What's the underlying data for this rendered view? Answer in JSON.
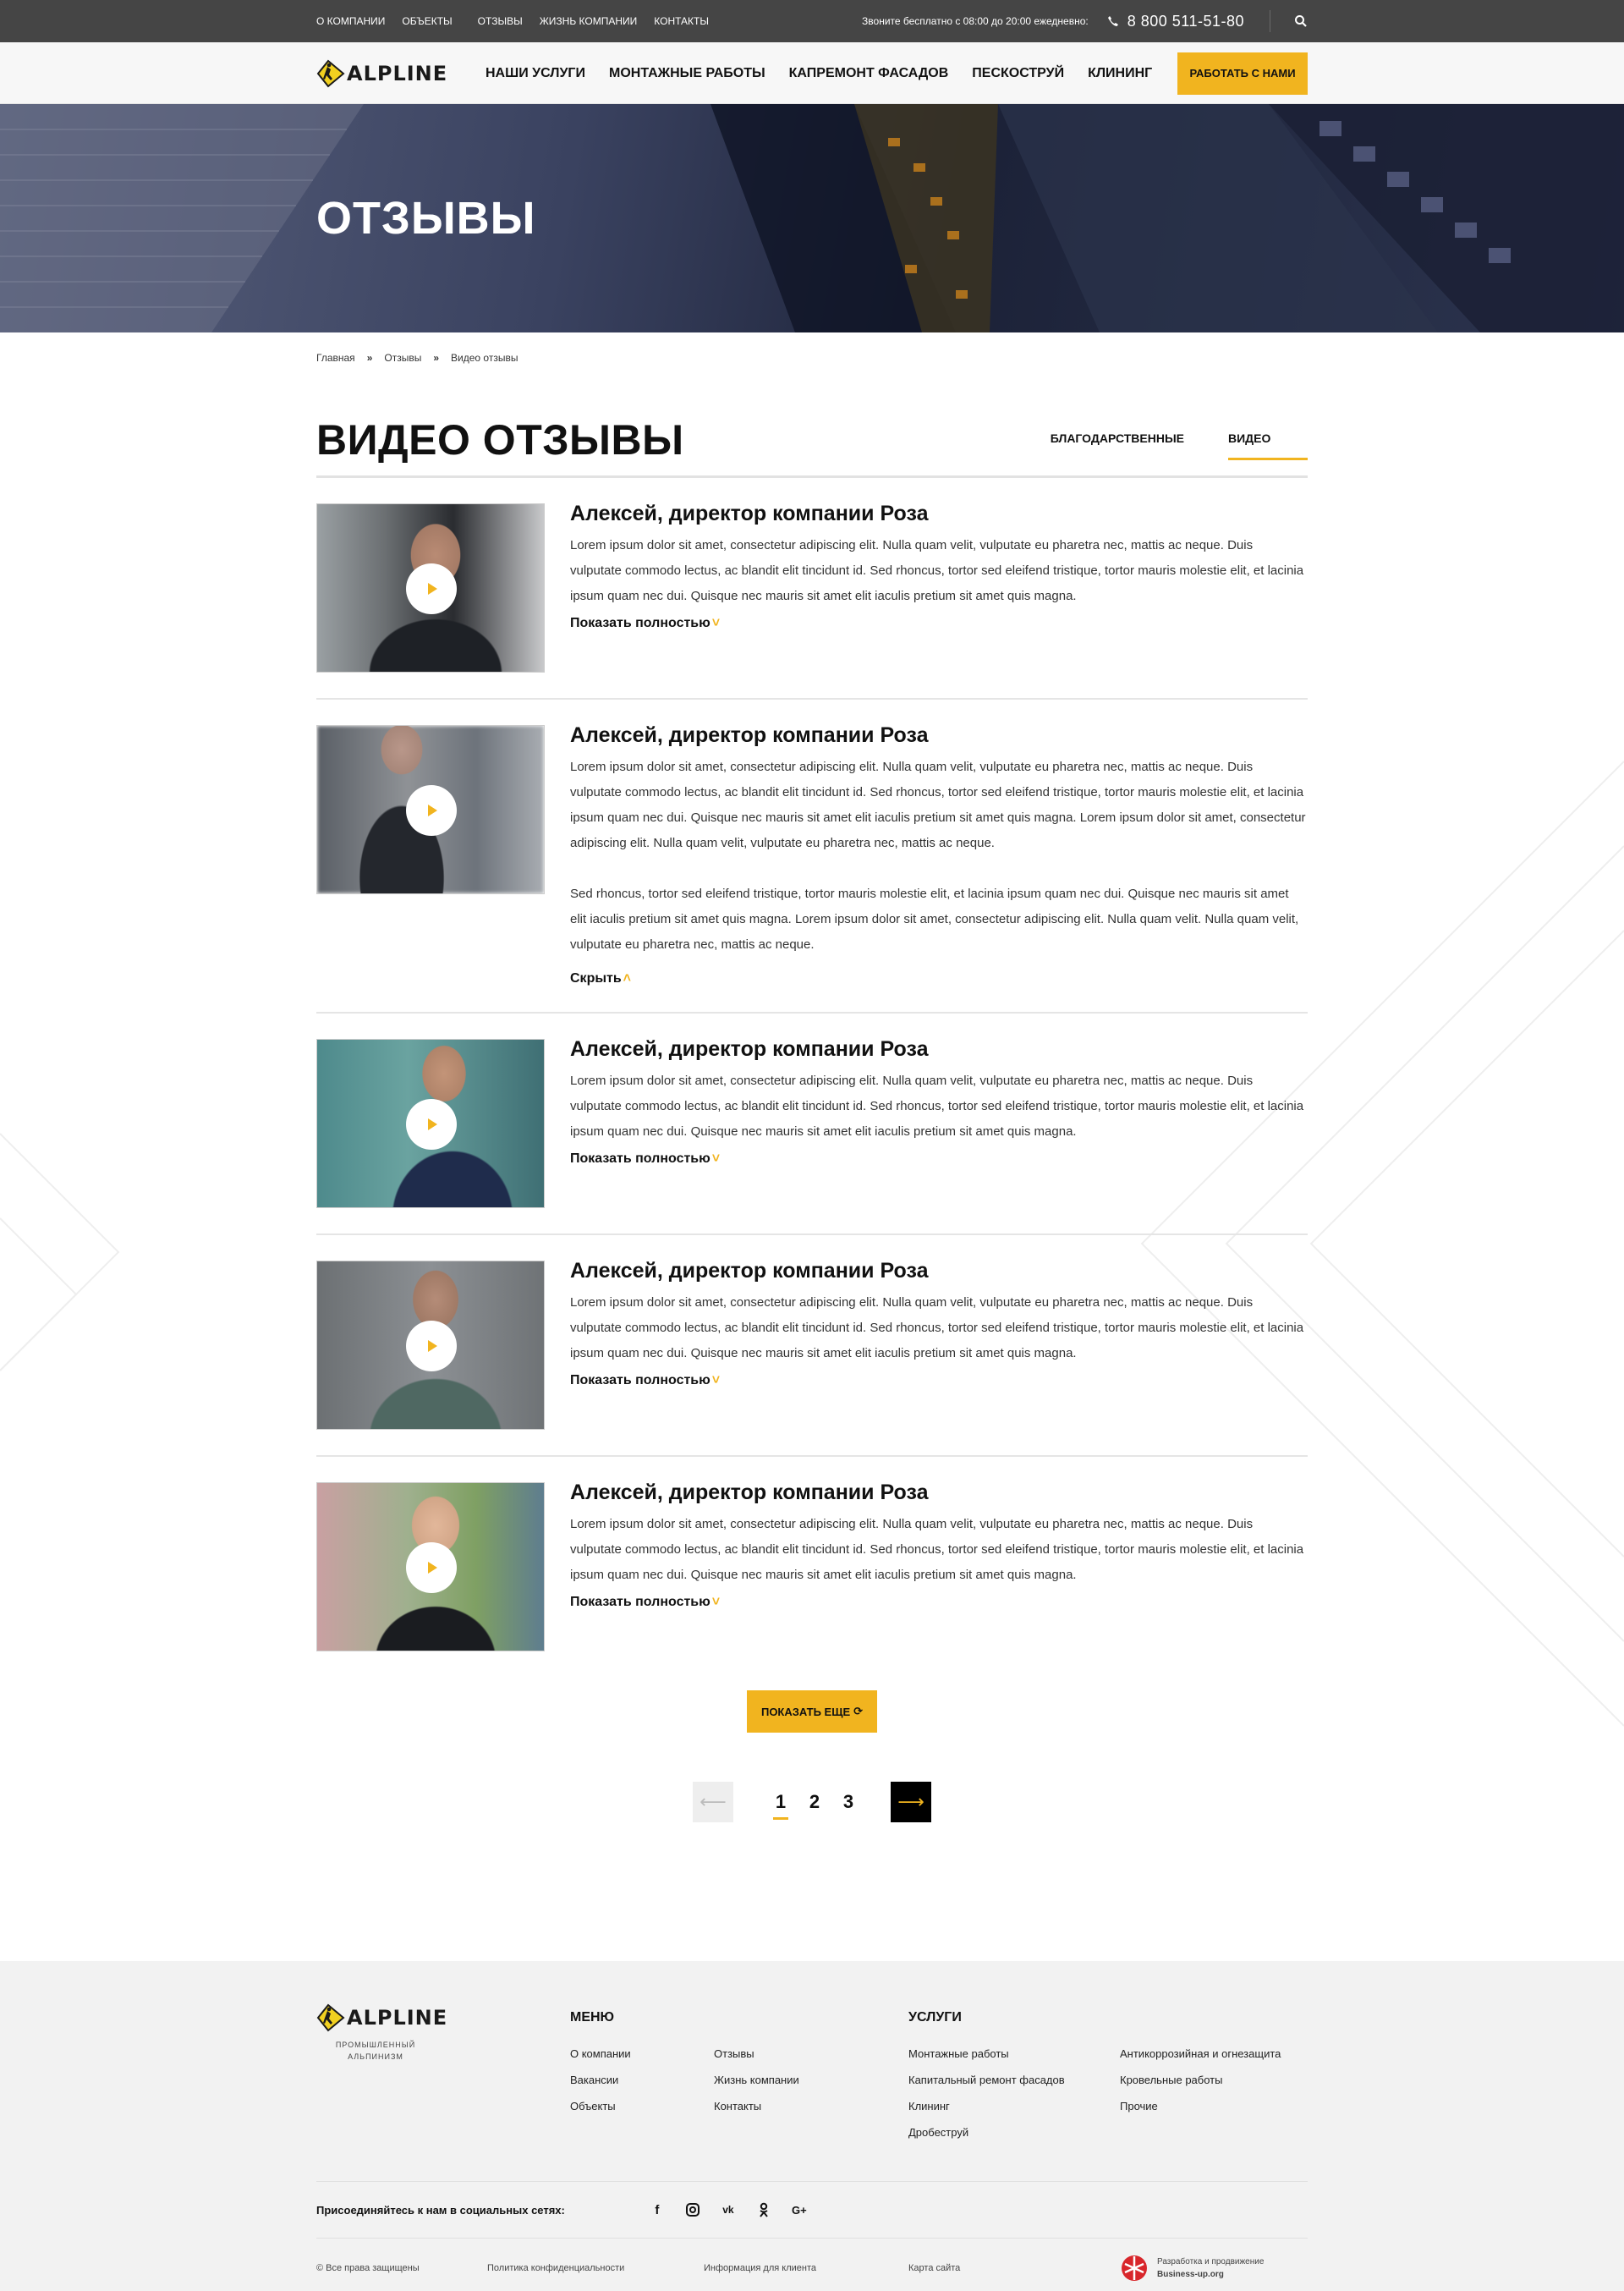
{
  "topbar": {
    "nav": [
      "О компании",
      "Объекты",
      "Отзывы",
      "Жизнь компании",
      "Контакты"
    ],
    "call_text": "Звоните бесплатно с 08:00 до 20:00 ежедневно:",
    "phone": "8 800 511-51-80"
  },
  "header": {
    "logo_text": "ALPLINE",
    "nav": [
      "Наши услуги",
      "Монтажные работы",
      "Капремонт фасадов",
      "Пескоструй",
      "Клининг"
    ],
    "cta": "Работать с нами"
  },
  "hero": {
    "title": "ОТЗЫВЫ"
  },
  "breadcrumb": [
    "Главная",
    "Отзывы",
    "Видео отзывы"
  ],
  "page": {
    "title": "ВИДЕО ОТЗЫВЫ",
    "tabs": [
      "Благодарственные",
      "Видео"
    ]
  },
  "reviews": [
    {
      "name": "Алексей, директор компании Роза",
      "text": "Lorem ipsum dolor sit amet, consectetur adipiscing elit. Nulla quam velit, vulputate eu pharetra nec, mattis ac neque. Duis vulputate commodo lectus, ac blandit elit tincidunt id. Sed rhoncus, tortor sed eleifend tristique, tortor mauris molestie elit, et lacinia ipsum quam nec dui. Quisque nec mauris sit amet elit iaculis pretium sit amet quis magna.",
      "toggle": "Показать полностью"
    },
    {
      "name": "Алексей, директор компании Роза",
      "text": "Lorem ipsum dolor sit amet, consectetur adipiscing elit. Nulla quam velit, vulputate eu pharetra nec, mattis ac neque. Duis vulputate commodo lectus, ac blandit elit tincidunt id. Sed rhoncus, tortor sed eleifend tristique, tortor mauris molestie elit, et lacinia ipsum quam nec dui. Quisque nec mauris sit amet elit iaculis pretium sit amet quis magna. Lorem ipsum dolor sit amet, consectetur adipiscing elit. Nulla quam velit, vulputate eu pharetra nec, mattis ac neque.",
      "text2": "Sed rhoncus, tortor sed eleifend tristique, tortor mauris molestie elit, et lacinia ipsum quam nec dui. Quisque nec mauris sit amet elit iaculis pretium sit amet quis magna. Lorem ipsum dolor sit amet, consectetur adipiscing elit. Nulla quam velit. Nulla quam velit, vulputate eu pharetra nec, mattis ac neque.",
      "toggle": "Скрыть"
    },
    {
      "name": "Алексей, директор компании Роза",
      "text": "Lorem ipsum dolor sit amet, consectetur adipiscing elit. Nulla quam velit, vulputate eu pharetra nec, mattis ac neque. Duis vulputate commodo lectus, ac blandit elit tincidunt id. Sed rhoncus, tortor sed eleifend tristique, tortor mauris molestie elit, et lacinia ipsum quam nec dui. Quisque nec mauris sit amet elit iaculis pretium sit amet quis magna.",
      "toggle": "Показать полностью"
    },
    {
      "name": "Алексей, директор компании Роза",
      "text": "Lorem ipsum dolor sit amet, consectetur adipiscing elit. Nulla quam velit, vulputate eu pharetra nec, mattis ac neque. Duis vulputate commodo lectus, ac blandit elit tincidunt id. Sed rhoncus, tortor sed eleifend tristique, tortor mauris molestie elit, et lacinia ipsum quam nec dui. Quisque nec mauris sit amet elit iaculis pretium sit amet quis magna.",
      "toggle": "Показать полностью"
    },
    {
      "name": "Алексей, директор компании Роза",
      "text": "Lorem ipsum dolor sit amet, consectetur adipiscing elit. Nulla quam velit, vulputate eu pharetra nec, mattis ac neque. Duis vulputate commodo lectus, ac blandit elit tincidunt id. Sed rhoncus, tortor sed eleifend tristique, tortor mauris molestie elit, et lacinia ipsum quam nec dui. Quisque nec mauris sit amet elit iaculis pretium sit amet quis magna.",
      "toggle": "Показать полностью"
    }
  ],
  "load_more": "Показать еще",
  "pagination": {
    "pages": [
      "1",
      "2",
      "3"
    ],
    "current": "1"
  },
  "footer": {
    "slogan": "Промышленный альпинизм",
    "menu_title": "Меню",
    "menu_col1": [
      "О компании",
      "Вакансии",
      "Объекты"
    ],
    "menu_col2": [
      "Отзывы",
      "Жизнь компании",
      "Контакты"
    ],
    "services_title": "Услуги",
    "services_col1": [
      "Монтажные работы",
      "Капитальный ремонт фасадов",
      "Клининг",
      "Дробеструй"
    ],
    "services_col2": [
      "Антикоррозийная и огнезащита",
      "Кровельные работы",
      "Прочие"
    ],
    "social_label": "Присоединяйтесь к нам в социальных сетях:",
    "bottom": [
      "© Все права защищены",
      "Политика конфиденциальности",
      "Информация для клиента",
      "Карта сайта"
    ],
    "dev_line1": "Разработка и продвижение",
    "dev_line2": "Business-up.org"
  },
  "colors": {
    "accent": "#f1b41f",
    "topbar": "#454545",
    "footer_bg": "#f2f2f2"
  }
}
